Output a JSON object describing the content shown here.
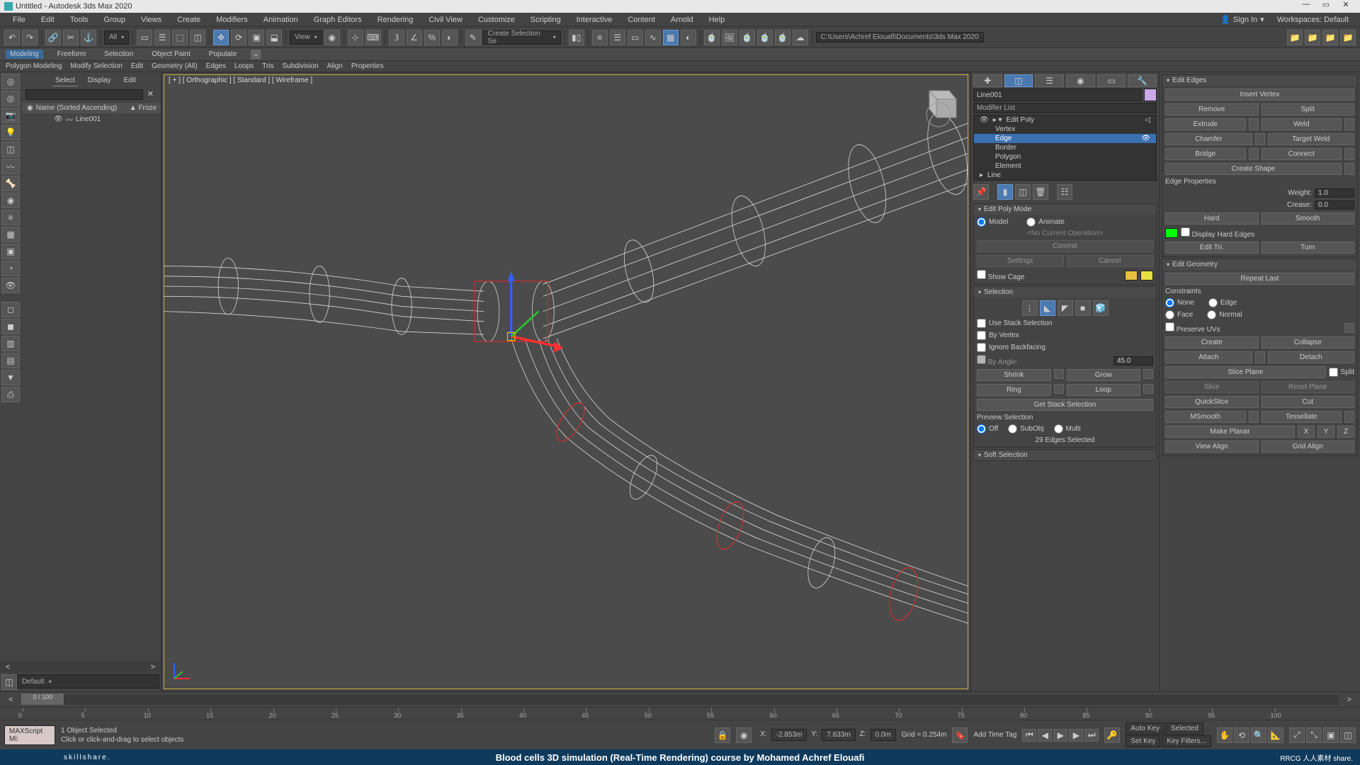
{
  "title": "Untitled - Autodesk 3ds Max 2020",
  "menus": [
    "File",
    "Edit",
    "Tools",
    "Group",
    "Views",
    "Create",
    "Modifiers",
    "Animation",
    "Graph Editors",
    "Rendering",
    "Civil View",
    "Customize",
    "Scripting",
    "Interactive",
    "Content",
    "Arnold",
    "Help"
  ],
  "signin": "Sign In",
  "workspace": {
    "label": "Workspaces:",
    "value": "Default"
  },
  "toolbar": {
    "all": "All",
    "view": "View",
    "create_sel": "Create Selection Se",
    "path": "C:\\Users\\Achref Elouafi\\Documents\\3ds Max 2020"
  },
  "ribbon": {
    "tabs": [
      "Modeling",
      "Freeform",
      "Selection",
      "Object Paint",
      "Populate"
    ]
  },
  "subribbon": [
    "Polygon Modeling",
    "Modify Selection",
    "Edit",
    "Geometry (All)",
    "Edges",
    "Loops",
    "Tris",
    "Subdivision",
    "Align",
    "Properties"
  ],
  "scene": {
    "tabs": [
      "Select",
      "Display",
      "Edit"
    ],
    "header": {
      "name": "Name (Sorted Ascending)",
      "frozen": "▲ Froze"
    },
    "item": "Line001",
    "search_close": "✕"
  },
  "viewport": {
    "label": "[ + ] [ Orthographic ] [ Standard ] [ Wireframe ]"
  },
  "cmd": {
    "name": "Line001",
    "modlist": "Modifier List",
    "stack": {
      "editpoly": "Edit Poly",
      "sub": [
        "Vertex",
        "Edge",
        "Border",
        "Polygon",
        "Element"
      ],
      "line": "Line"
    },
    "rollouts": {
      "editpolymode": "Edit Poly Mode",
      "model": "Model",
      "animate": "Animate",
      "noop": "<No Current Operation>",
      "commit": "Commit",
      "settings": "Settings",
      "cancel": "Cancel",
      "showcage": "Show Cage",
      "selection": "Selection",
      "usestack": "Use Stack Selection",
      "byvertex": "By Vertex",
      "ignoreback": "Ignore Backfacing",
      "byangle": "By Angle:",
      "angleval": "45.0",
      "shrink": "Shrink",
      "grow": "Grow",
      "ring": "Ring",
      "loop": "Loop",
      "getstack": "Get Stack Selection",
      "preview": "Preview Selection",
      "off": "Off",
      "subobj": "SubObj",
      "multi": "Multi",
      "edgesel": "29 Edges Selected",
      "softsel": "Soft Selection"
    }
  },
  "edit": {
    "editedges": "Edit Edges",
    "insertv": "Insert Vertex",
    "remove": "Remove",
    "split": "Split",
    "extrude": "Extrude",
    "weld": "Weld",
    "chamfer": "Chamfer",
    "targetweld": "Target Weld",
    "bridge": "Bridge",
    "connect": "Connect",
    "createshape": "Create Shape",
    "edgeprops": "Edge Properties",
    "weight": "Weight:",
    "weightv": "1.0",
    "crease": "Crease:",
    "creasev": "0.0",
    "hard": "Hard",
    "smooth": "Smooth",
    "displayhard": "Display Hard Edges",
    "edittri": "Edit Tri.",
    "turn": "Turn",
    "editgeom": "Edit Geometry",
    "repeatlast": "Repeat Last",
    "constraints": "Constraints",
    "none": "None",
    "edge": "Edge",
    "face": "Face",
    "normal": "Normal",
    "preserveuv": "Preserve UVs",
    "create": "Create",
    "collapse": "Collapse",
    "attach": "Attach",
    "detach": "Detach",
    "sliceplane": "Slice Plane",
    "split2": "Split",
    "slice": "Slice",
    "resetplane": "Reset Plane",
    "quickslice": "QuickSlice",
    "cut": "Cut",
    "msmooth": "MSmooth",
    "tessellate": "Tessellate",
    "makeplanar": "Make Planar",
    "x": "X",
    "y": "Y",
    "z": "Z",
    "viewalign": "View Align",
    "gridalign": "Grid Align"
  },
  "time": {
    "frame": "0 / 100",
    "ticks": [
      "0",
      "5",
      "10",
      "15",
      "20",
      "25",
      "30",
      "35",
      "40",
      "45",
      "50",
      "55",
      "60",
      "65",
      "70",
      "75",
      "80",
      "85",
      "90",
      "95",
      "100"
    ]
  },
  "status": {
    "sel": "1 Object Selected",
    "hint": "Click or click-and-drag to select objects",
    "script": "MAXScript Mi:",
    "x": "X:",
    "xv": "-2.853m",
    "y": "Y:",
    "yv": "7.633m",
    "z": "Z:",
    "zv": "0.0m",
    "grid": "Grid = 0.254m",
    "addtag": "Add Time Tag",
    "autokey": "Auto Key",
    "selected": "Selected",
    "setkey": "Set Key",
    "keyfilters": "Key Filters..."
  },
  "footer": {
    "left": "skillshare.",
    "title": "Blood cells 3D simulation (Real-Time Rendering) course by Mohamed Achref Elouafi",
    "right": "RRCG 人人素材 share."
  }
}
